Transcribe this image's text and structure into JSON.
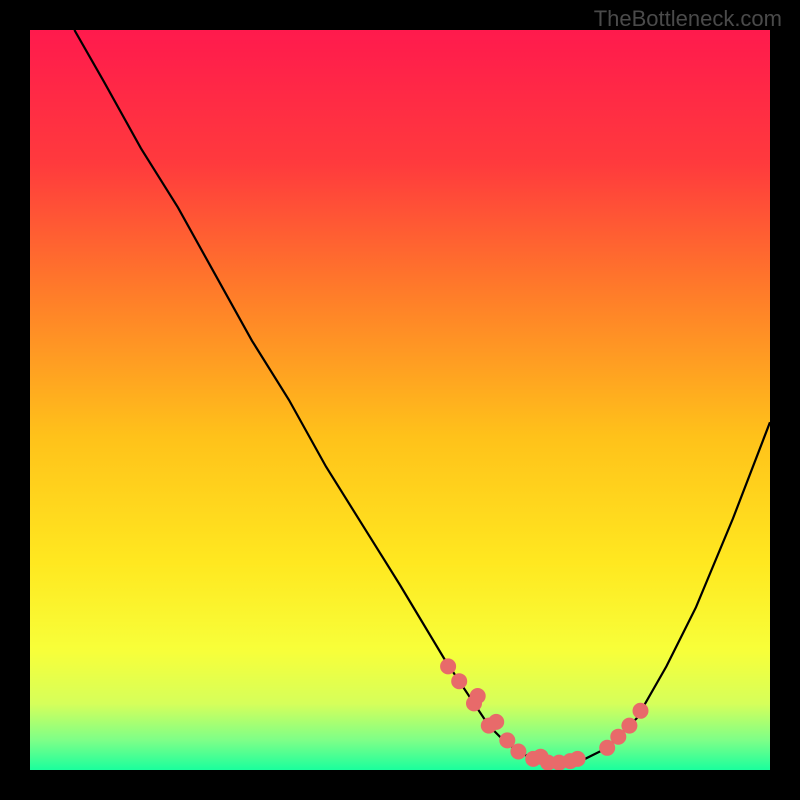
{
  "watermark": "TheBottleneck.com",
  "chart_data": {
    "type": "line",
    "title": "",
    "xlabel": "",
    "ylabel": "",
    "xlim": [
      0,
      100
    ],
    "ylim": [
      0,
      100
    ],
    "gradient_stops": [
      {
        "offset": 0,
        "color": "#ff1a4d"
      },
      {
        "offset": 18,
        "color": "#ff3a3d"
      },
      {
        "offset": 35,
        "color": "#ff7a2a"
      },
      {
        "offset": 55,
        "color": "#ffc21a"
      },
      {
        "offset": 72,
        "color": "#ffe820"
      },
      {
        "offset": 84,
        "color": "#f7ff3a"
      },
      {
        "offset": 91,
        "color": "#d6ff5a"
      },
      {
        "offset": 96,
        "color": "#7dff88"
      },
      {
        "offset": 100,
        "color": "#1aff9d"
      }
    ],
    "series": [
      {
        "name": "bottleneck-curve",
        "x": [
          6,
          10,
          15,
          20,
          25,
          30,
          35,
          40,
          45,
          50,
          53,
          56,
          58,
          60,
          62,
          64,
          66,
          68,
          70,
          72,
          75,
          78,
          82,
          86,
          90,
          95,
          100
        ],
        "y": [
          100,
          93,
          84,
          76,
          67,
          58,
          50,
          41,
          33,
          25,
          20,
          15,
          12,
          9,
          6,
          4,
          2.5,
          1.5,
          1,
          1,
          1.5,
          3,
          7,
          14,
          22,
          34,
          47
        ]
      }
    ],
    "markers": {
      "name": "highlight-dots",
      "color": "#e86a6a",
      "radius": 8,
      "x": [
        56.5,
        58,
        60,
        60.5,
        62,
        63,
        64.5,
        66,
        68,
        69,
        70,
        71.5,
        73,
        74,
        78,
        79.5,
        81,
        82.5
      ],
      "y": [
        14,
        12,
        9,
        10,
        6,
        6.5,
        4,
        2.5,
        1.5,
        1.8,
        1,
        1,
        1.2,
        1.5,
        3,
        4.5,
        6,
        8
      ]
    }
  }
}
